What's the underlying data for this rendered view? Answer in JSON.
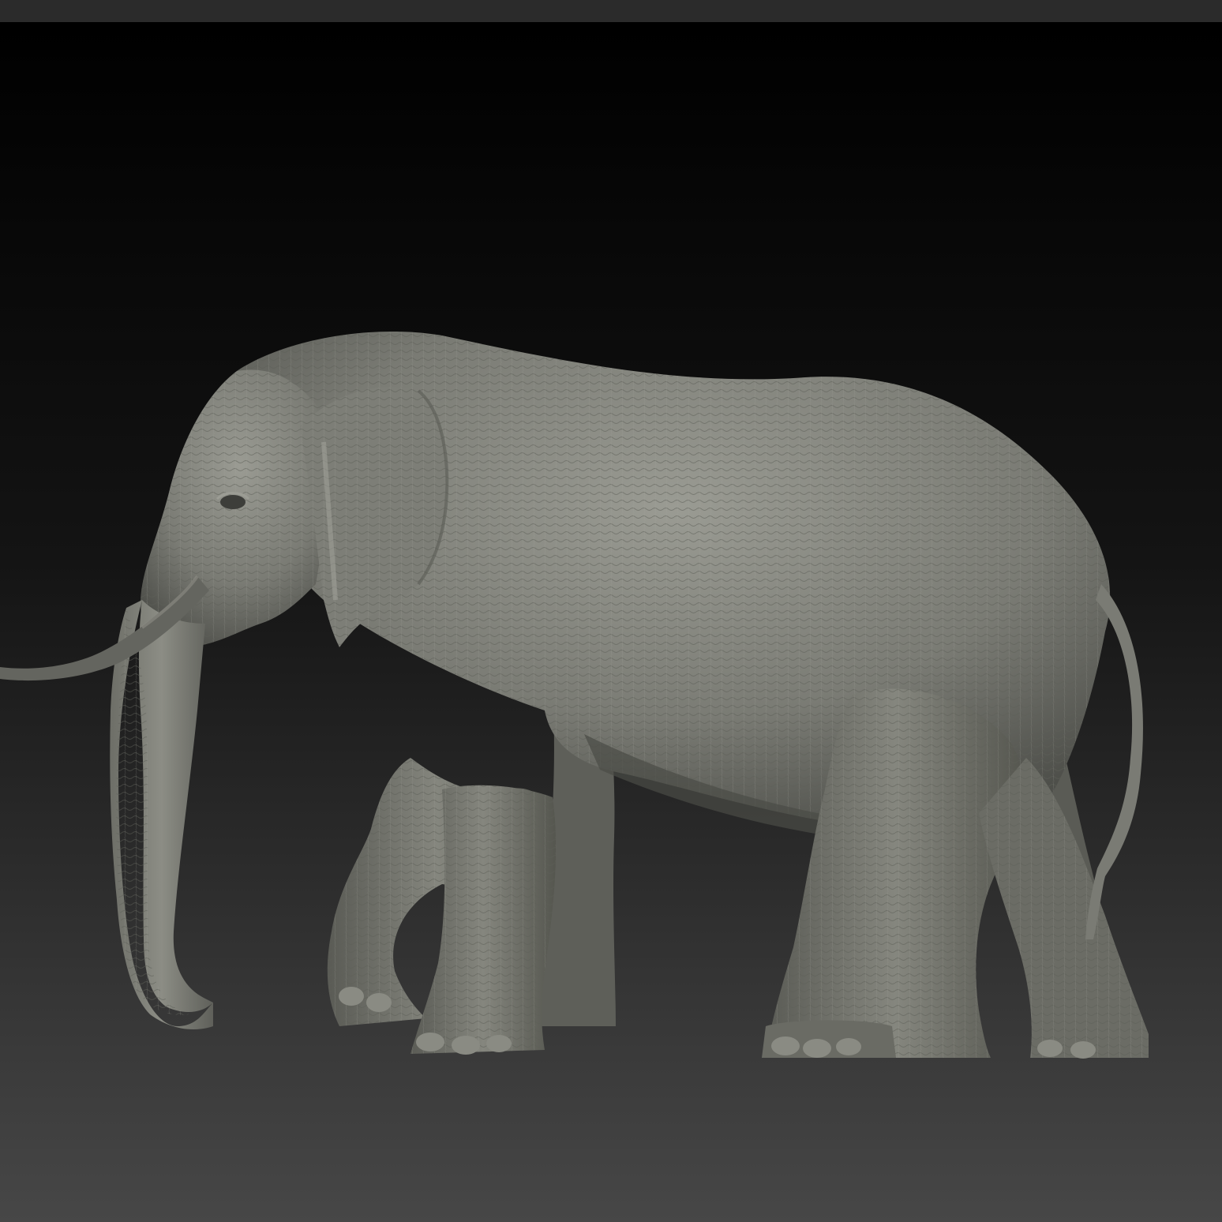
{
  "scene": {
    "subject": "elephant-sculpt",
    "background": {
      "top_strip": "#2b2b2b",
      "gradient_top": "#000000",
      "gradient_mid": "#141414",
      "gradient_bottom": "#474747"
    },
    "material": {
      "base": "#7a7b74",
      "light": "#9a9b93",
      "shadow": "#4e4f4a",
      "deep_shadow": "#3a3b37"
    }
  }
}
